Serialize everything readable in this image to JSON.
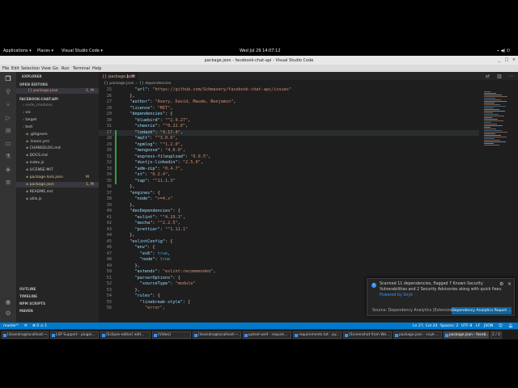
{
  "gnome": {
    "applications": "Applications ▾",
    "places": "Places ▾",
    "app": "Visual Studio Code ▾",
    "clock": "Wed Jul 29  14:07:12",
    "tray": "⌁ ◀) ⏻"
  },
  "window": {
    "title": "package.json - facebook-chat-api - Visual Studio Code"
  },
  "menu": [
    "File",
    "Edit",
    "Selection",
    "View",
    "Go",
    "Run",
    "Terminal",
    "Help"
  ],
  "activity": [
    "files-icon",
    "search-icon",
    "source-control-icon",
    "debug-icon",
    "extensions-icon",
    "remote-icon",
    "test-icon",
    "docker-icon",
    "tree-icon"
  ],
  "sidebar": {
    "header": "EXPLORER",
    "open_editors": "OPEN EDITORS",
    "open_file": "{} package.json",
    "open_file_badge": "1, M",
    "project": "FACEBOOK-CHAT-API",
    "items": [
      {
        "label": "node_modules",
        "badge": ""
      },
      {
        "label": "src",
        "badge": ""
      },
      {
        "label": "target",
        "badge": ""
      },
      {
        "label": "test",
        "badge": ""
      },
      {
        "label": ".gitignore",
        "badge": ""
      },
      {
        "label": ".travis.yml",
        "badge": ""
      },
      {
        "label": "CHANGELOG.md",
        "badge": ""
      },
      {
        "label": "DOCS.md",
        "badge": ""
      },
      {
        "label": "index.js",
        "badge": ""
      },
      {
        "label": "LICENSE-MIT",
        "badge": ""
      },
      {
        "label": "package-lock.json",
        "badge": "M"
      },
      {
        "label": "package.json",
        "badge": "1, M"
      },
      {
        "label": "README.md",
        "badge": ""
      },
      {
        "label": "utils.js",
        "badge": ""
      }
    ],
    "bottom": [
      "OUTLINE",
      "TIMELINE",
      "NPM SCRIPTS",
      "MAVEN"
    ]
  },
  "tab": {
    "label": "{} package.json",
    "badge": "1, M"
  },
  "breadcrumb": [
    "{} package.json",
    "›",
    "{} dependencies"
  ],
  "code": [
    {
      "n": "25",
      "t": "    \"url\": \"https://github.com/Schmavery/facebook-chat-api/issues\""
    },
    {
      "n": "26",
      "t": "  },"
    },
    {
      "n": "27",
      "t": "  \"author\": \"Avery, David, Maude, Benjamin\","
    },
    {
      "n": "28",
      "t": "  \"license\": \"MIT\","
    },
    {
      "n": "29",
      "t": "  \"dependencies\": {"
    },
    {
      "n": "30",
      "t": "    \"bluebird\": \"^2.9.27\","
    },
    {
      "n": "31",
      "t": "    \"cheerio\": \"^0.22.0\","
    },
    {
      "n": "27",
      "t": "    \"lodash\": \"4.17.4\","
    },
    {
      "n": "28",
      "t": "    \"mqtt\": \"^3.0.0\","
    },
    {
      "n": "29",
      "t": "    \"npmlog\": \"^1.2.0\","
    },
    {
      "n": "30",
      "t": "    \"mongoose\": \"4.0.0\","
    },
    {
      "n": "31",
      "t": "    \"express-fileupload\": \"0.0.5\","
    },
    {
      "n": "32",
      "t": "    \"dustjs-linkedin\": \"2.5.0\","
    },
    {
      "n": "33",
      "t": "    \"adm-zip\": \"0.4.7\","
    },
    {
      "n": "34",
      "t": "    \"st\": \"0.2.4\","
    },
    {
      "n": "35",
      "t": "    \"tap\": \"^11.1.3\""
    },
    {
      "n": "36",
      "t": "  },"
    },
    {
      "n": "37",
      "t": "  \"engines\": {"
    },
    {
      "n": "38",
      "t": "    \"node\": \">=4.x\""
    },
    {
      "n": "39",
      "t": "  },"
    },
    {
      "n": "40",
      "t": "  \"devDependencies\": {"
    },
    {
      "n": "41",
      "t": "    \"eslint\": \"^4.19.1\","
    },
    {
      "n": "42",
      "t": "    \"mocha\": \"^2.2.5\","
    },
    {
      "n": "43",
      "t": "    \"prettier\": \"^1.11.1\""
    },
    {
      "n": "44",
      "t": "  },"
    },
    {
      "n": "45",
      "t": "  \"eslintConfig\": {"
    },
    {
      "n": "46",
      "t": "    \"env\": {"
    },
    {
      "n": "47",
      "t": "      \"es6\": true,"
    },
    {
      "n": "48",
      "t": "      \"node\": true"
    },
    {
      "n": "49",
      "t": "    },"
    },
    {
      "n": "50",
      "t": "    \"extends\": \"eslint:recommended\","
    },
    {
      "n": "51",
      "t": "    \"parserOptions\": {"
    },
    {
      "n": "52",
      "t": "      \"sourceType\": \"module\""
    },
    {
      "n": "53",
      "t": "    },"
    },
    {
      "n": "54",
      "t": "    \"rules\": {"
    },
    {
      "n": "55",
      "t": "      \"linebreak-style\": ["
    },
    {
      "n": "56",
      "t": "        \"error\","
    }
  ],
  "notification": {
    "line1": "Scanned 11 dependencies, flagged 7 Known Security",
    "line2": "Vulnerabilities and 2 Security Advisories along with quick fixes.",
    "line3": "Powered by Snyk",
    "source": "Source: Dependency Analytics (Extension)",
    "button": "Dependency Analytics Report ..."
  },
  "status": {
    "branch": "master*",
    "sync": "⟳",
    "problems": "⊗ 0 ⚠ 1",
    "position": "Ln 27, Col 24",
    "spaces": "Spaces: 2",
    "encoding": "UTF-8",
    "eol": "LF",
    "lang": "JSON"
  },
  "taskbar": [
    "[dvandra@localhost:~...",
    "LSP Support - plugin...",
    "[Eclipse-editor] edit...",
    "[Video]",
    "[dvandra@localhost:~...",
    "pytest-well - require...",
    "requirements.txt - py...",
    "[Screenshot from We...",
    "package.json - snyk-...",
    "package.json - faceb...",
    "2 / 4"
  ],
  "colors": {
    "accent": "#007acc",
    "editor_bg": "#1e1e1e",
    "sidebar_bg": "#252526",
    "activity_bg": "#333333",
    "button": "#0e639c"
  }
}
